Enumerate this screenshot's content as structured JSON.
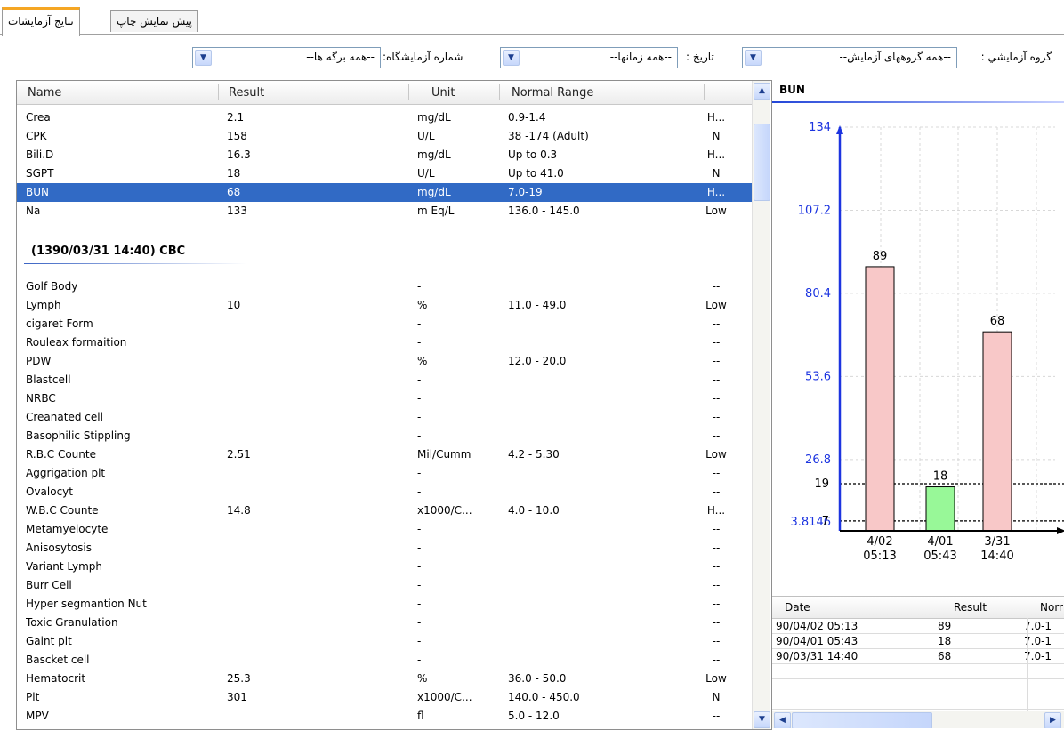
{
  "tabs": [
    {
      "label": "نتایج آزمایشات",
      "active": true
    },
    {
      "label": "پیش نمایش چاپ",
      "active": false
    }
  ],
  "filters": {
    "group_label": "گروه آزمایشي :",
    "group_value": "--همه گروههای آزمایش--",
    "date_label": "تاریخ :",
    "date_value": "--همه زمانها--",
    "lab_label": "شماره آزمایشگاه:",
    "lab_value": "--همه برگه ها--"
  },
  "table": {
    "columns": [
      "Name",
      "Result",
      "Unit",
      "Normal Range",
      ""
    ],
    "rows_top": [
      {
        "name": "Crea",
        "result": "2.1",
        "unit": "mg/dL",
        "range": "0.9-1.4",
        "flag": "H..."
      },
      {
        "name": "CPK",
        "result": "158",
        "unit": "U/L",
        "range": "38 -174 (Adult)",
        "flag": "N"
      },
      {
        "name": "Bili.D",
        "result": "16.3",
        "unit": "mg/dL",
        "range": "Up to 0.3",
        "flag": "H..."
      },
      {
        "name": "SGPT",
        "result": "18",
        "unit": "U/L",
        "range": "Up to 41.0",
        "flag": "N"
      },
      {
        "name": "BUN",
        "result": "68",
        "unit": "mg/dL",
        "range": "7.0-19",
        "flag": "H...",
        "selected": true
      },
      {
        "name": "Na",
        "result": "133",
        "unit": "m Eq/L",
        "range": "136.0 - 145.0",
        "flag": "Low"
      }
    ],
    "group_title": "(1390/03/31 14:40) CBC",
    "rows_group": [
      {
        "name": "Golf Body",
        "result": "",
        "unit": "-",
        "range": "",
        "flag": "--"
      },
      {
        "name": "Lymph",
        "result": "10",
        "unit": "%",
        "range": "11.0 - 49.0",
        "flag": "Low"
      },
      {
        "name": "cigaret Form",
        "result": "",
        "unit": "-",
        "range": "",
        "flag": "--"
      },
      {
        "name": "Rouleax formaition",
        "result": "",
        "unit": "-",
        "range": "",
        "flag": "--"
      },
      {
        "name": "PDW",
        "result": "",
        "unit": "%",
        "range": "12.0 - 20.0",
        "flag": "--"
      },
      {
        "name": "Blastcell",
        "result": "",
        "unit": "-",
        "range": "",
        "flag": "--"
      },
      {
        "name": "NRBC",
        "result": "",
        "unit": "-",
        "range": "",
        "flag": "--"
      },
      {
        "name": "Creanated cell",
        "result": "",
        "unit": "-",
        "range": "",
        "flag": "--"
      },
      {
        "name": "Basophilic Stippling",
        "result": "",
        "unit": "-",
        "range": "",
        "flag": "--"
      },
      {
        "name": "R.B.C Counte",
        "result": "2.51",
        "unit": "Mil/Cumm",
        "range": "4.2 - 5.30",
        "flag": "Low"
      },
      {
        "name": "Aggrigation plt",
        "result": "",
        "unit": "-",
        "range": "",
        "flag": "--"
      },
      {
        "name": "Ovalocyt",
        "result": "",
        "unit": "-",
        "range": "",
        "flag": "--"
      },
      {
        "name": "W.B.C Counte",
        "result": "14.8",
        "unit": "x1000/C...",
        "range": "4.0 - 10.0",
        "flag": "H..."
      },
      {
        "name": "Metamyelocyte",
        "result": "",
        "unit": "-",
        "range": "",
        "flag": "--"
      },
      {
        "name": "Anisosytosis",
        "result": "",
        "unit": "-",
        "range": "",
        "flag": "--"
      },
      {
        "name": "Variant Lymph",
        "result": "",
        "unit": "-",
        "range": "",
        "flag": "--"
      },
      {
        "name": "Burr Cell",
        "result": "",
        "unit": "-",
        "range": "",
        "flag": "--"
      },
      {
        "name": "Hyper segmantion Nut",
        "result": "",
        "unit": "-",
        "range": "",
        "flag": "--"
      },
      {
        "name": "Toxic Granulation",
        "result": "",
        "unit": "-",
        "range": "",
        "flag": "--"
      },
      {
        "name": "Gaint plt",
        "result": "",
        "unit": "-",
        "range": "",
        "flag": "--"
      },
      {
        "name": "Bascket cell",
        "result": "",
        "unit": "-",
        "range": "",
        "flag": "--"
      },
      {
        "name": "Hematocrit",
        "result": "25.3",
        "unit": "%",
        "range": "36.0 - 50.0",
        "flag": "Low"
      },
      {
        "name": "Plt",
        "result": "301",
        "unit": "x1000/C...",
        "range": "140.0 - 450.0",
        "flag": "N"
      },
      {
        "name": "MPV",
        "result": "",
        "unit": "fl",
        "range": "5.0 - 12.0",
        "flag": "--"
      }
    ]
  },
  "chart_data": {
    "type": "bar",
    "title": "BUN",
    "categories": [
      "4/02 05:13",
      "4/01 05:43",
      "3/31 14:40"
    ],
    "category_lines": [
      [
        "4/02",
        "05:13"
      ],
      [
        "4/01",
        "05:43"
      ],
      [
        "3/31",
        "14:40"
      ]
    ],
    "values": [
      89,
      18,
      68
    ],
    "bar_status": [
      "high",
      "normal",
      "high"
    ],
    "ylim": [
      3.8146,
      134
    ],
    "yticks": [
      "134",
      "107.2",
      "80.4",
      "53.6",
      "26.8",
      "3.8146"
    ],
    "reference_lines": [
      {
        "label": "19",
        "value": 19
      },
      {
        "label": "7",
        "value": 7
      }
    ],
    "colors": {
      "high_fill": "#f8c8c8",
      "normal_fill": "#98f898",
      "axis": "#1c34e0",
      "tick_text": "#1c34e0"
    }
  },
  "history": {
    "columns": [
      "Date",
      "Result",
      "Norr"
    ],
    "rows": [
      {
        "date": "90/04/02 05:13",
        "result": "89",
        "range": "7.0-1"
      },
      {
        "date": "90/04/01 05:43",
        "result": "18",
        "range": "7.0-1"
      },
      {
        "date": "90/03/31 14:40",
        "result": "68",
        "range": "7.0-1"
      }
    ]
  }
}
